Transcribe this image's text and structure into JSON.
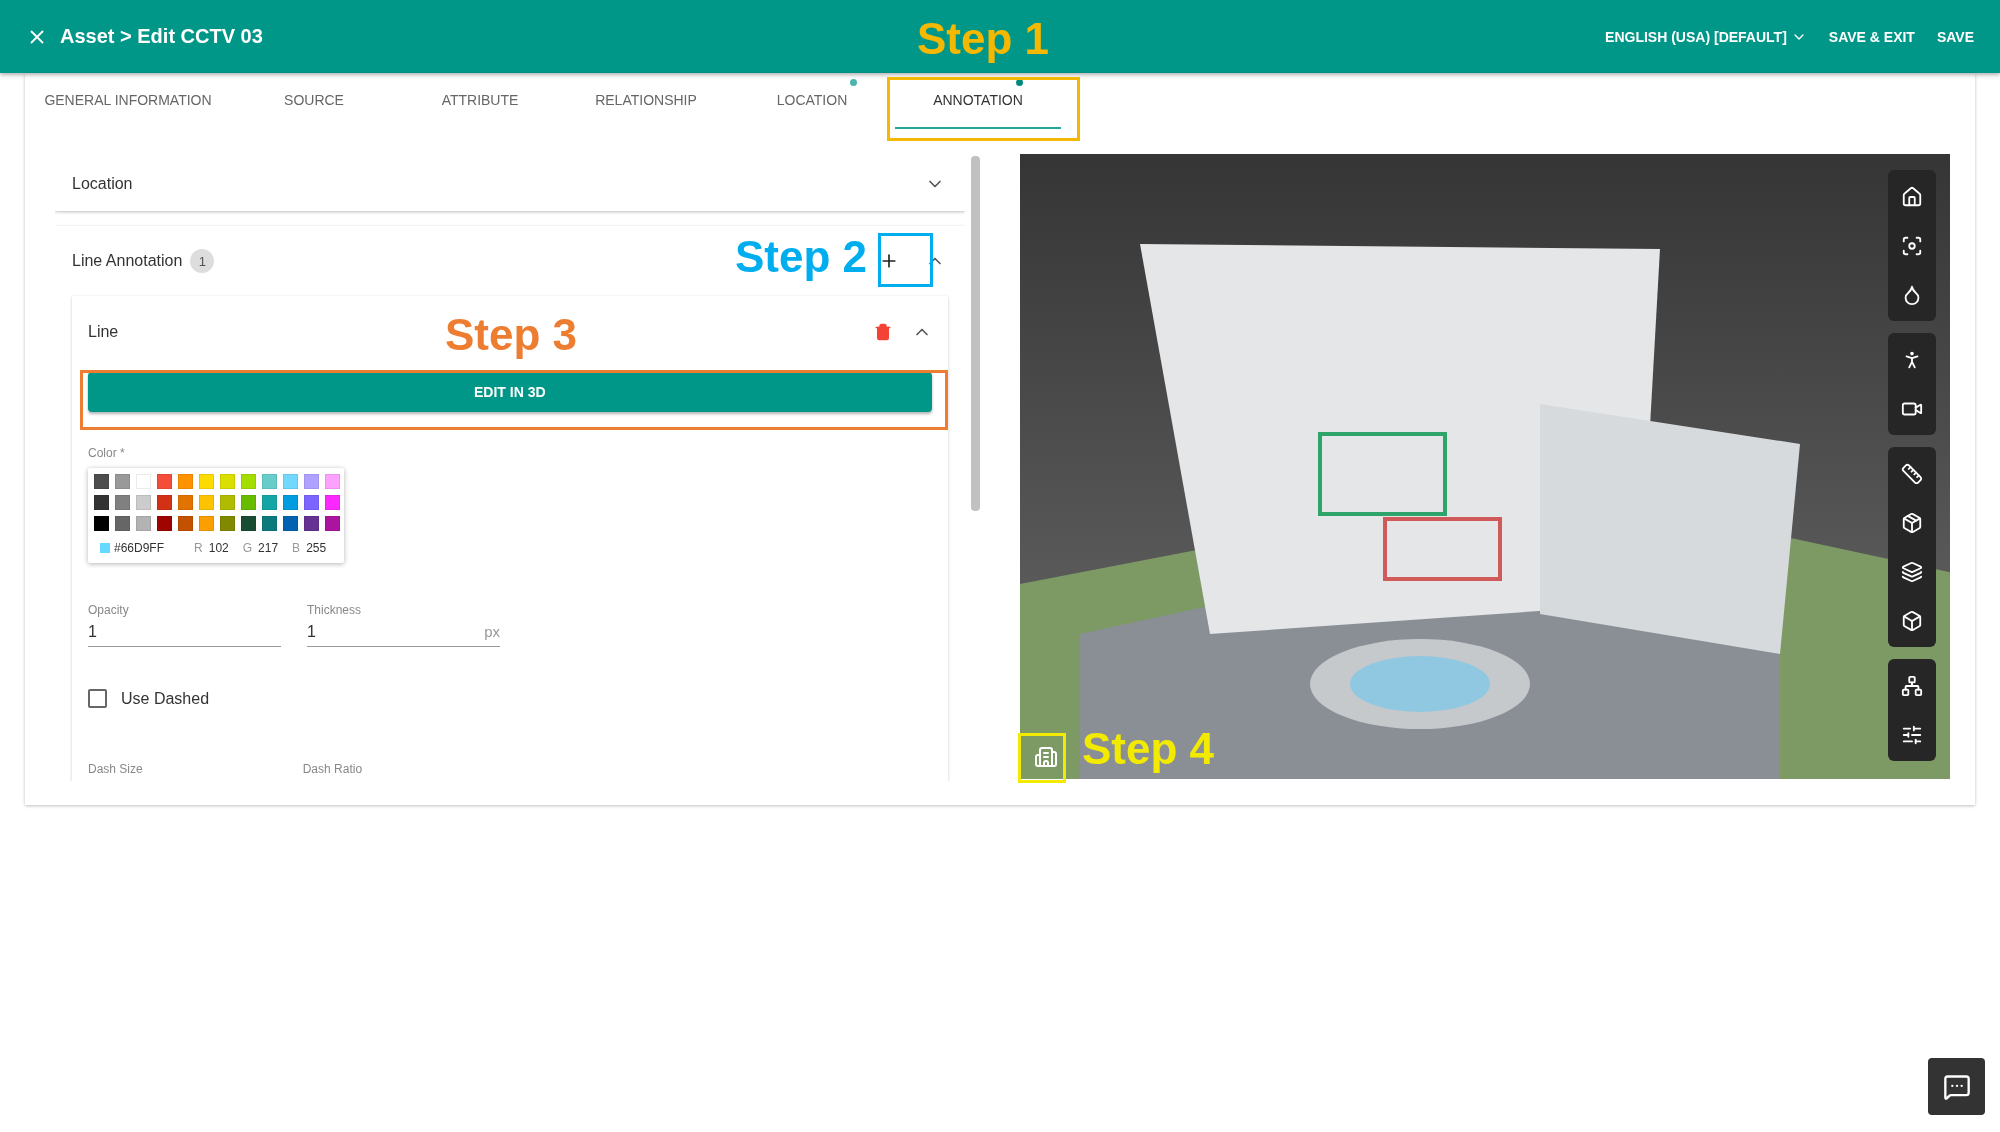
{
  "header": {
    "title": "Asset > Edit CCTV 03",
    "language": "ENGLISH (USA) [DEFAULT]",
    "actions": [
      "SAVE & EXIT",
      "SAVE"
    ]
  },
  "tabs": [
    {
      "label": "GENERAL INFORMATION",
      "selected": false,
      "dot": false
    },
    {
      "label": "SOURCE",
      "selected": false,
      "dot": false
    },
    {
      "label": "ATTRIBUTE",
      "selected": false,
      "dot": false
    },
    {
      "label": "RELATIONSHIP",
      "selected": false,
      "dot": false
    },
    {
      "label": "LOCATION",
      "selected": false,
      "dot": true
    },
    {
      "label": "ANNOTATION",
      "selected": true,
      "dot": true
    }
  ],
  "location_panel": {
    "title": "Location",
    "expanded": false
  },
  "line_annotation": {
    "title": "Line Annotation",
    "count": "1",
    "expanded": true,
    "line": {
      "title": "Line",
      "expanded": true,
      "button": "EDIT IN 3D",
      "color_label": "Color *",
      "swatches": [
        {
          "color": "#4d4d4d"
        },
        {
          "color": "#999999"
        },
        {
          "color": "#ffffff"
        },
        {
          "color": "#f44e3b"
        },
        {
          "color": "#fe9200"
        },
        {
          "color": "#fcdc00"
        },
        {
          "color": "#dbdf00"
        },
        {
          "color": "#a4dd00"
        },
        {
          "color": "#68ccca"
        },
        {
          "color": "#73d8ff"
        },
        {
          "color": "#aea1ff"
        },
        {
          "color": "#fda1ff"
        },
        {
          "color": "#333333"
        },
        {
          "color": "#808080"
        },
        {
          "color": "#cccccc"
        },
        {
          "color": "#d33115"
        },
        {
          "color": "#e27300"
        },
        {
          "color": "#fcc400"
        },
        {
          "color": "#b0bc00"
        },
        {
          "color": "#68bc00"
        },
        {
          "color": "#16a5a5"
        },
        {
          "color": "#009ce0"
        },
        {
          "color": "#7b64ff"
        },
        {
          "color": "#fa28ff"
        },
        {
          "color": "#000000"
        },
        {
          "color": "#666666"
        },
        {
          "color": "#b3b3b3"
        },
        {
          "color": "#9f0500"
        },
        {
          "color": "#c45100"
        },
        {
          "color": "#fb9e00"
        },
        {
          "color": "#808900"
        },
        {
          "color": "#194d33"
        },
        {
          "color": "#0c797d"
        },
        {
          "color": "#0062b1"
        },
        {
          "color": "#653294"
        },
        {
          "color": "#ab149e"
        }
      ],
      "hex": "#66D9FF",
      "r_label": "R",
      "r": "102",
      "g_label": "G",
      "g": "217",
      "b_label": "B",
      "b": "255",
      "opacity_label": "Opacity",
      "opacity": "1",
      "thickness_label": "Thickness",
      "thickness": "1",
      "unit": "px",
      "dashed_label": "Use Dashed",
      "dashed": false,
      "dash_size_label": "Dash Size",
      "dash_ratio_label": "Dash Ratio"
    }
  },
  "steps": [
    {
      "label": "Step 1",
      "color": "#f5b800"
    },
    {
      "label": "Step 2",
      "color": "#00aeef"
    },
    {
      "label": "Step 3",
      "color": "#ed7d31"
    },
    {
      "label": "Step 4",
      "color": "#f2ea00"
    }
  ]
}
